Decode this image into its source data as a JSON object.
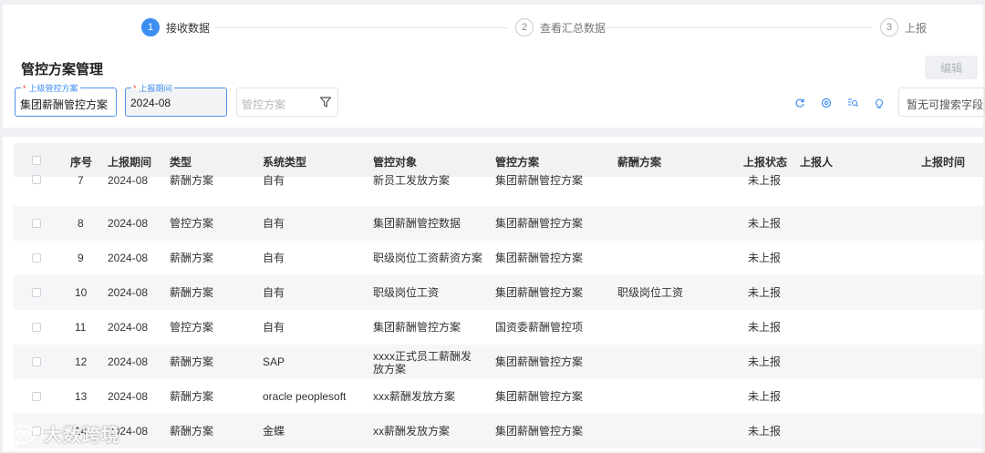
{
  "steps": [
    {
      "num": "1",
      "label": "接收数据"
    },
    {
      "num": "2",
      "label": "查看汇总数据"
    },
    {
      "num": "3",
      "label": "上报"
    }
  ],
  "page_title": "管控方案管理",
  "edit_label": "编辑",
  "filters": {
    "parent_plan": {
      "label": "上级管控方案",
      "required": "*",
      "value": "集团薪酬管控方案"
    },
    "period": {
      "label": "上报期间",
      "required": "*",
      "value": "2024-08"
    },
    "plan": {
      "placeholder": "管控方案"
    }
  },
  "search": {
    "placeholder": "暂无可搜索字段"
  },
  "table": {
    "headers": {
      "seq": "序号",
      "period": "上报期间",
      "type": "类型",
      "system": "系统类型",
      "object": "管控对象",
      "plan": "管控方案",
      "salary": "薪酬方案",
      "status": "上报状态",
      "reporter": "上报人",
      "time": "上报时间"
    },
    "rows": [
      {
        "seq": "7",
        "period": "2024-08",
        "type": "薪酬方案",
        "system": "自有",
        "object": "新员工发放方案",
        "plan": "集团薪酬管控方案",
        "salary": "",
        "status": "未上报"
      },
      {
        "seq": "8",
        "period": "2024-08",
        "type": "管控方案",
        "system": "自有",
        "object": "集团薪酬管控数据",
        "plan": "集团薪酬管控方案",
        "salary": "",
        "status": "未上报"
      },
      {
        "seq": "9",
        "period": "2024-08",
        "type": "薪酬方案",
        "system": "自有",
        "object": "职级岗位工资薪资方案",
        "plan": "集团薪酬管控方案",
        "salary": "",
        "status": "未上报"
      },
      {
        "seq": "10",
        "period": "2024-08",
        "type": "薪酬方案",
        "system": "自有",
        "object": "职级岗位工资",
        "plan": "集团薪酬管控方案",
        "salary": "职级岗位工资",
        "status": "未上报"
      },
      {
        "seq": "11",
        "period": "2024-08",
        "type": "管控方案",
        "system": "自有",
        "object": "集团薪酬管控方案",
        "plan": "国资委薪酬管控项",
        "salary": "",
        "status": "未上报"
      },
      {
        "seq": "12",
        "period": "2024-08",
        "type": "薪酬方案",
        "system": "SAP",
        "object": "xxxx正式员工薪酬发放方案",
        "plan": "集团薪酬管控方案",
        "salary": "",
        "status": "未上报"
      },
      {
        "seq": "13",
        "period": "2024-08",
        "type": "薪酬方案",
        "system": "oracle peoplesoft",
        "object": "xxx薪酬发放方案",
        "plan": "集团薪酬管控方案",
        "salary": "",
        "status": "未上报"
      },
      {
        "seq": "14",
        "period": "2024-08",
        "type": "薪酬方案",
        "system": "金蝶",
        "object": "xx薪酬发放方案",
        "plan": "集团薪酬管控方案",
        "salary": "",
        "status": "未上报"
      }
    ]
  },
  "watermark": "大数跨境",
  "colors": {
    "accent": "#3d8ef0",
    "required": "#e8463a"
  }
}
